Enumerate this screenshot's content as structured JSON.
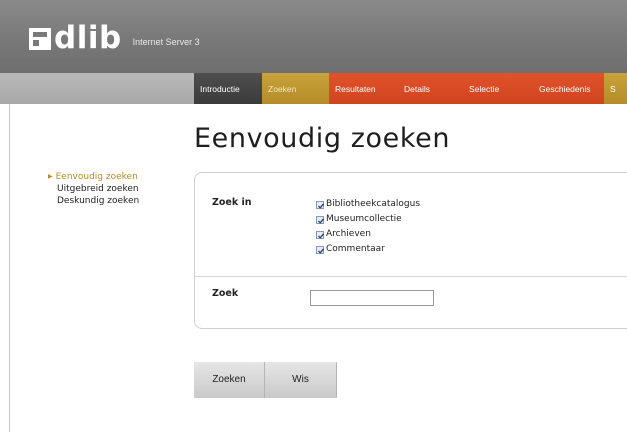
{
  "header": {
    "logo_text": "dlib",
    "subtitle": "Internet Server 3",
    "logo_icon": "adlib-mark-icon"
  },
  "nav": {
    "tabs": [
      {
        "label": "Introductie",
        "state": "dark"
      },
      {
        "label": "Zoeken",
        "state": "active"
      },
      {
        "label": "Resultaten",
        "state": "red"
      },
      {
        "label": "Details",
        "state": "red"
      },
      {
        "label": "Selectie",
        "state": "red"
      },
      {
        "label": "Geschiedenis",
        "state": "red"
      },
      {
        "label": "S",
        "state": "olive"
      }
    ]
  },
  "sidebar": {
    "items": [
      {
        "label": "Eenvoudig zoeken",
        "active": true
      },
      {
        "label": "Uitgebreid zoeken",
        "active": false
      },
      {
        "label": "Deskundig zoeken",
        "active": false
      }
    ]
  },
  "main": {
    "title": "Eenvoudig zoeken",
    "zoek_in_label": "Zoek in",
    "sources": [
      {
        "label": "Bibliotheekcatalogus",
        "checked": true
      },
      {
        "label": "Museumcollectie",
        "checked": true
      },
      {
        "label": "Archieven",
        "checked": true
      },
      {
        "label": "Commentaar",
        "checked": true
      }
    ],
    "zoek_label": "Zoek",
    "zoek_value": ""
  },
  "buttons": {
    "search": "Zoeken",
    "clear": "Wis"
  },
  "colors": {
    "accent": "#b58c28",
    "tab_red": "#cf4420",
    "tab_dark": "#3b3b3b",
    "header": "#7a7a7a"
  }
}
